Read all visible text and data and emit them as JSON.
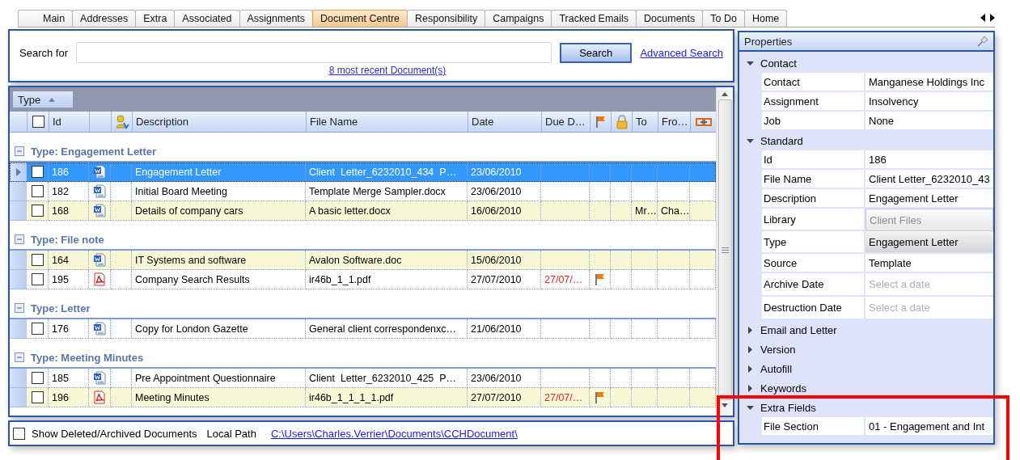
{
  "tabs": [
    {
      "label": "Main",
      "selected": false
    },
    {
      "label": "Addresses",
      "selected": false
    },
    {
      "label": "Extra",
      "selected": false
    },
    {
      "label": "Associated",
      "selected": false
    },
    {
      "label": "Assignments",
      "selected": false
    },
    {
      "label": "Document Centre",
      "selected": true
    },
    {
      "label": "Responsibility",
      "selected": false
    },
    {
      "label": "Campaigns",
      "selected": false
    },
    {
      "label": "Tracked Emails",
      "selected": false
    },
    {
      "label": "Documents",
      "selected": false
    },
    {
      "label": "To Do",
      "selected": false
    },
    {
      "label": "Home",
      "selected": false
    }
  ],
  "search": {
    "label": "Search for",
    "button": "Search",
    "advanced_link": "Advanced Search",
    "recent_link": "8 most recent Document(s)"
  },
  "grid": {
    "group_by": "Type",
    "columns": [
      {
        "kind": "checkbox",
        "checked": false
      },
      {
        "kind": "text",
        "label": "Id"
      },
      {
        "kind": "blank"
      },
      {
        "kind": "icon"
      },
      {
        "kind": "text",
        "label": "Description"
      },
      {
        "kind": "text",
        "label": "File Name"
      },
      {
        "kind": "text",
        "label": "Date"
      },
      {
        "kind": "text",
        "label": "Due D…"
      },
      {
        "kind": "icon"
      },
      {
        "kind": "icon"
      },
      {
        "kind": "text",
        "label": "To"
      },
      {
        "kind": "text",
        "label": "Fro…"
      },
      {
        "kind": "icon"
      }
    ],
    "groups": [
      {
        "title": "Type: Engagement Letter",
        "expanded": true,
        "rows": [
          {
            "kind": "word",
            "id": "186",
            "description": "Engagement Letter",
            "file_name": "Client  Letter_6232010_434  P…",
            "date": "23/06/2010",
            "selected": true,
            "checked": false
          },
          {
            "kind": "word",
            "id": "182",
            "description": "Initial Board Meeting",
            "file_name": "Template Merge Sampler.docx",
            "date": "23/06/2010",
            "selected": false,
            "highlighted": false,
            "checked": false
          },
          {
            "kind": "word",
            "id": "168",
            "description": "Details of company cars",
            "file_name": "A basic letter.docx",
            "date": "16/06/2010",
            "to": "Mr…",
            "from": "Cha…",
            "selected": false,
            "highlighted": true,
            "checked": false
          }
        ]
      },
      {
        "title": "Type: File note",
        "expanded": true,
        "rows": [
          {
            "kind": "word",
            "id": "164",
            "description": "IT Systems and software",
            "file_name": "Avalon Software.doc",
            "date": "15/06/2010",
            "selected": false,
            "highlighted": true,
            "checked": false
          },
          {
            "kind": "pdf",
            "id": "195",
            "description": "Company Search Results",
            "file_name": "ir46b_1_1.pdf",
            "date": "27/07/2010",
            "due_date": "27/07/…",
            "overdue": true,
            "flagged": true,
            "selected": false,
            "highlighted": false,
            "checked": false
          }
        ]
      },
      {
        "title": "Type: Letter",
        "expanded": true,
        "rows": [
          {
            "kind": "word",
            "id": "176",
            "description": "Copy for London Gazette",
            "file_name": "General client correspondenxc…",
            "date": "21/06/2010",
            "selected": false,
            "highlighted": false,
            "checked": false
          }
        ]
      },
      {
        "title": "Type: Meeting Minutes",
        "expanded": true,
        "rows": [
          {
            "kind": "word",
            "id": "185",
            "description": "Pre Appointment Questionnaire",
            "file_name": "Client  Letter_6232010_425  P…",
            "date": "23/06/2010",
            "selected": false,
            "highlighted": false,
            "checked": false
          },
          {
            "kind": "pdf",
            "id": "196",
            "description": "Meeting Minutes",
            "file_name": "ir46b_1_1_1_1.pdf",
            "date": "27/07/2010",
            "due_date": "27/07/…",
            "overdue": true,
            "flagged": true,
            "selected": false,
            "highlighted": true,
            "checked": false
          }
        ]
      }
    ]
  },
  "footer": {
    "show_deleted": {
      "label": "Show Deleted/Archived Documents",
      "checked": false
    },
    "path_label": "Local Path",
    "path": "C:\\Users\\Charles.Verrier\\Documents\\CCHDocument\\"
  },
  "properties": {
    "title": "Properties",
    "categories": [
      {
        "name": "Contact",
        "expanded": true,
        "properties": [
          {
            "name": "Contact",
            "value": "Manganese Holdings Inc",
            "kind": "text"
          },
          {
            "name": "Assignment",
            "value": "Insolvency",
            "kind": "text"
          },
          {
            "name": "Job",
            "value": "None",
            "kind": "text"
          }
        ]
      },
      {
        "name": "Standard",
        "expanded": true,
        "properties": [
          {
            "name": "Id",
            "value": "186",
            "kind": "text"
          },
          {
            "name": "File Name",
            "value": "Client Letter_6232010_43",
            "kind": "text"
          },
          {
            "name": "Description",
            "value": "Engagement Letter",
            "kind": "text"
          },
          {
            "name": "Library",
            "value": "Client Files",
            "kind": "disabled"
          },
          {
            "name": "Type",
            "value": "Engagement Letter",
            "kind": "dropdown"
          },
          {
            "name": "Source",
            "value": "Template",
            "kind": "text"
          },
          {
            "name": "Archive Date",
            "placeholder": "Select a date",
            "kind": "date"
          },
          {
            "name": "Destruction Date",
            "placeholder": "Select a date",
            "kind": "date"
          }
        ]
      },
      {
        "name": "Email and Letter",
        "expanded": false
      },
      {
        "name": "Version",
        "expanded": false
      },
      {
        "name": "Autofill",
        "expanded": false
      },
      {
        "name": "Keywords",
        "expanded": false
      },
      {
        "name": "Extra Fields",
        "expanded": true,
        "properties": [
          {
            "name": "File Section",
            "value": "01 - Engagement and Int",
            "kind": "text"
          }
        ]
      }
    ]
  },
  "highlight_frame": {
    "shown": true
  }
}
